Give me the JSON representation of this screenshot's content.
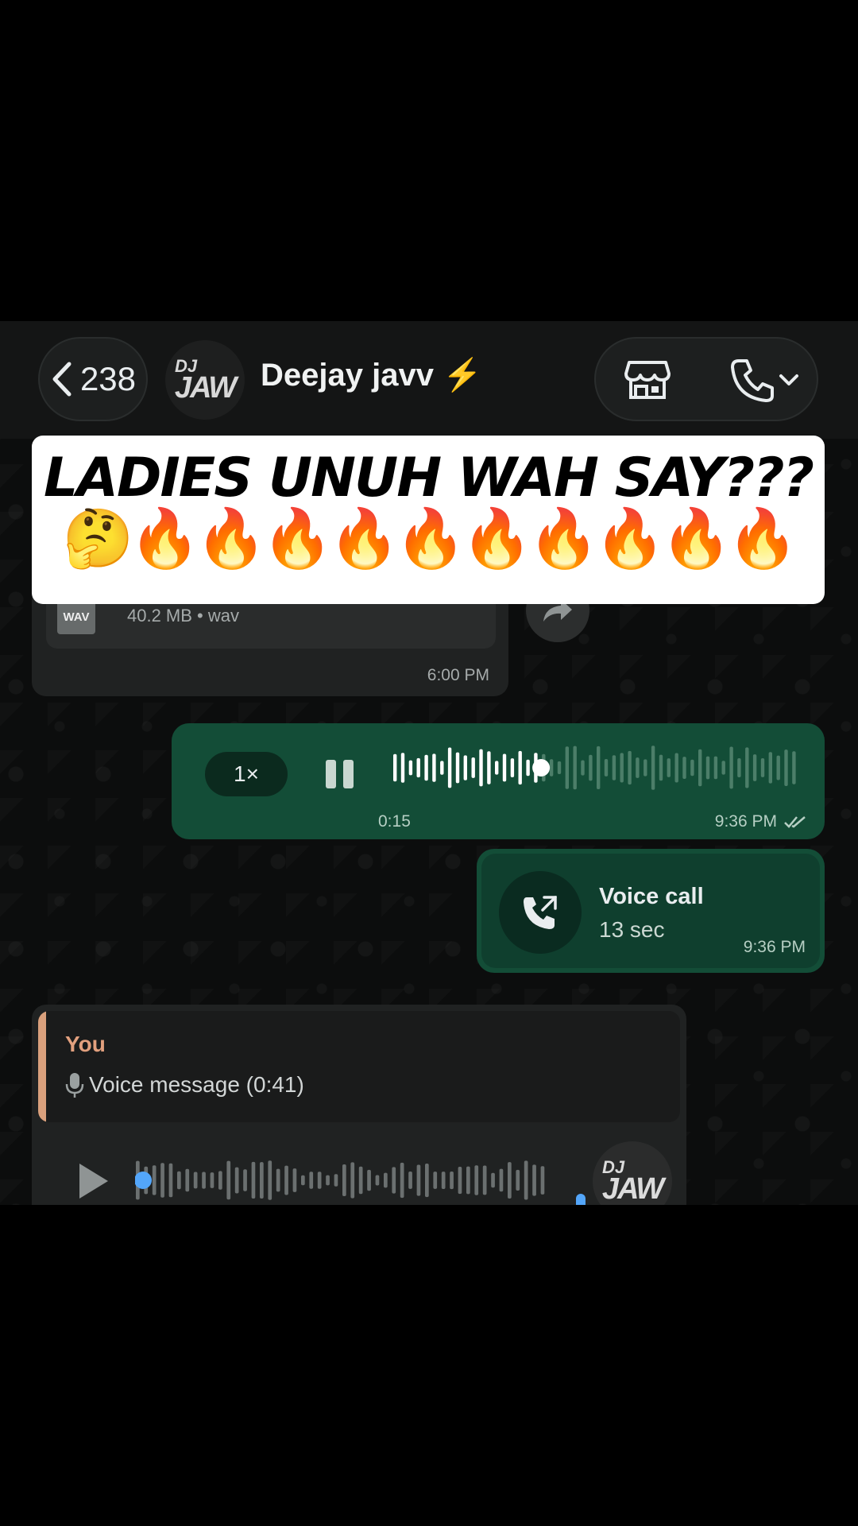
{
  "header": {
    "back_count": "238",
    "avatar_line1": "DJ",
    "avatar_line2": "JAW",
    "contact_name": "Deejay javv ⚡"
  },
  "banner": {
    "title": "LADIES UNUH WAH SAY???",
    "emojis": "🤔🔥🔥🔥🔥🔥🔥🔥🔥🔥🔥"
  },
  "messages": {
    "file": {
      "icon_label": "WAV",
      "meta": "40.2 MB • wav",
      "time": "6:00 PM"
    },
    "voice_note": {
      "speed": "1×",
      "duration": "0:15",
      "time": "9:36 PM",
      "progress": 0.37
    },
    "voice_call": {
      "title": "Voice call",
      "subtitle": "13 sec",
      "time": "9:36 PM"
    },
    "reply": {
      "quote_author": "You",
      "quote_text": "Voice message (0:41)",
      "avatar_line1": "DJ",
      "avatar_line2": "JAW",
      "progress": 0.0
    }
  },
  "colors": {
    "outgoing_bubble": "#134d37",
    "incoming_bubble": "#202222",
    "quote_accent": "#d9a07c",
    "play_dot": "#53a6fa"
  }
}
